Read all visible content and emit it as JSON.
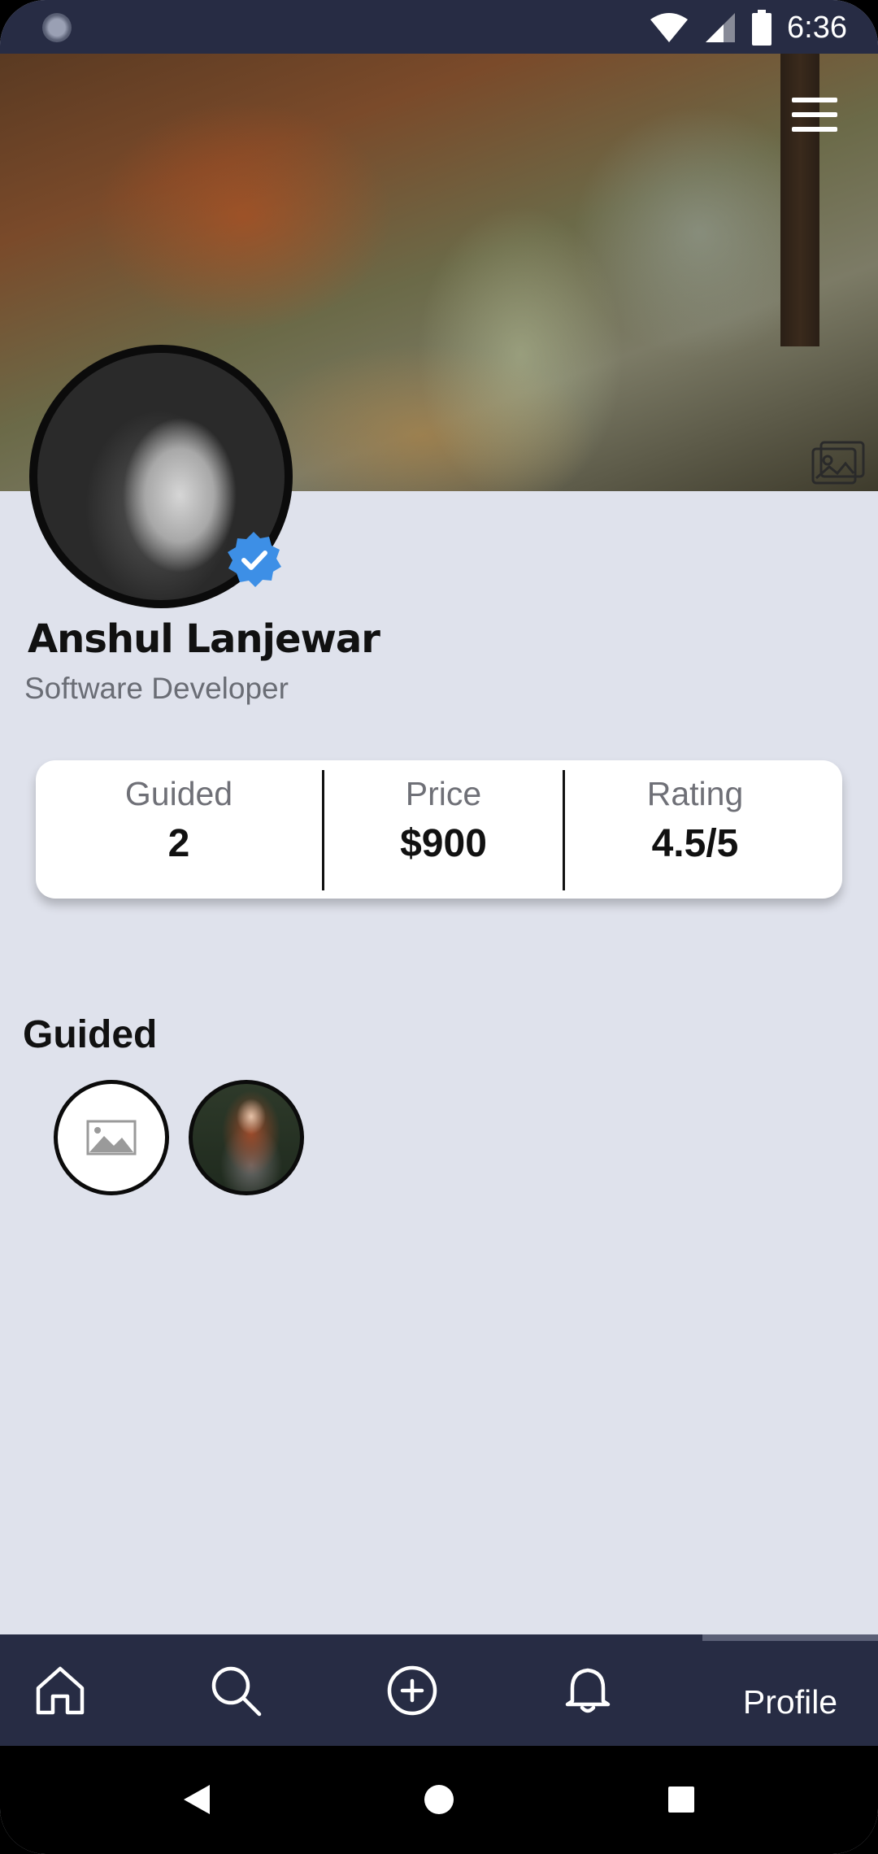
{
  "status_bar": {
    "time": "6:36",
    "icons": [
      "wifi-icon",
      "signal-icon",
      "battery-icon"
    ]
  },
  "header": {
    "menu_icon": "hamburger-menu-icon",
    "cover_edit_icon": "image-edit-icon"
  },
  "profile": {
    "name": "Anshul Lanjewar",
    "role": "Software Developer",
    "verified": true
  },
  "stats": [
    {
      "label": "Guided",
      "value": "2"
    },
    {
      "label": "Price",
      "value": "$900"
    },
    {
      "label": "Rating",
      "value": "4.5/5"
    }
  ],
  "guided_section": {
    "title": "Guided",
    "items": [
      "image-placeholder-icon",
      "guided-user-avatar"
    ]
  },
  "bottom_nav": {
    "items": [
      "home-icon",
      "search-icon",
      "add-circle-icon",
      "bell-icon"
    ],
    "active_label": "Profile"
  },
  "colors": {
    "bar_background": "#272c44",
    "page_background": "#dfe2ec",
    "verified_blue": "#3d8fe6"
  }
}
